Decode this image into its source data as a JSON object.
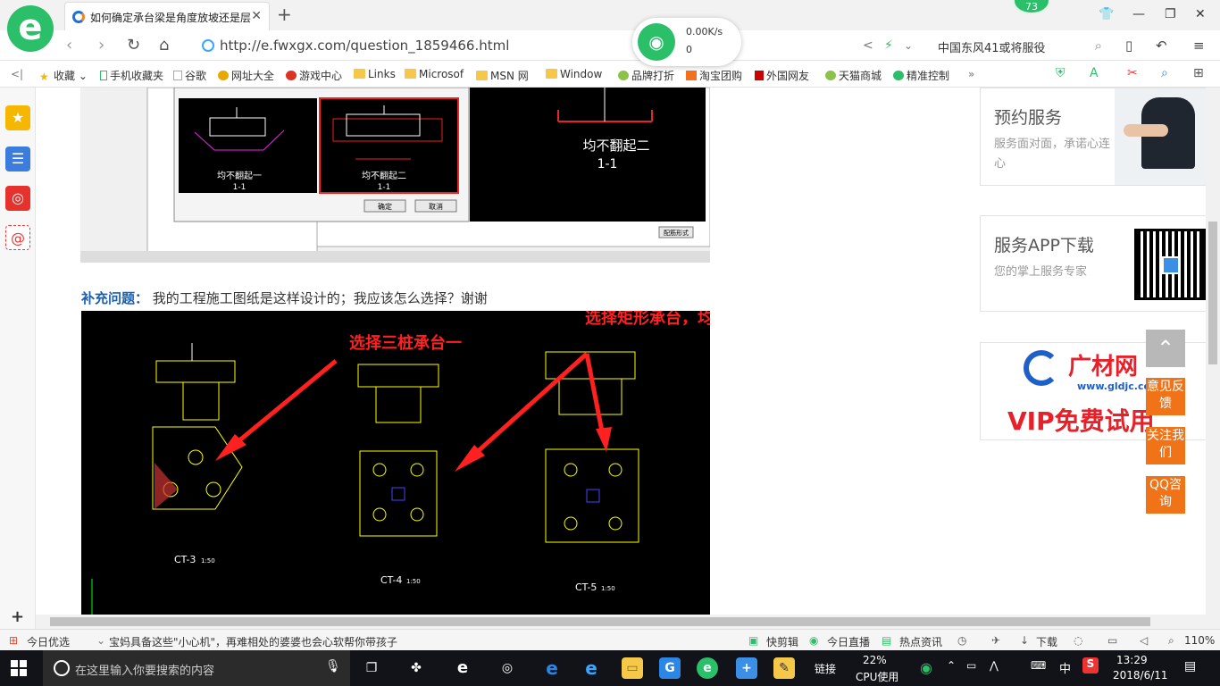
{
  "tab": {
    "title": "如何确定承台梁是角度放坡还是层"
  },
  "titlebar": {
    "badge": "73"
  },
  "address": {
    "url": "http://e.fwxgx.com/question_1859466.html",
    "net_speed": "0.00K/s",
    "net_count": "0"
  },
  "search": {
    "text": "中国东风41或将服役"
  },
  "bookmarks": [
    {
      "label": "收藏"
    },
    {
      "label": "手机收藏夹"
    },
    {
      "label": "谷歌"
    },
    {
      "label": "网址大全"
    },
    {
      "label": "游戏中心"
    },
    {
      "label": "Links"
    },
    {
      "label": "Microsof"
    },
    {
      "label": "MSN 网"
    },
    {
      "label": "Window"
    },
    {
      "label": "品牌打折"
    },
    {
      "label": "淘宝团购"
    },
    {
      "label": "外国网友"
    },
    {
      "label": "天猫商城"
    },
    {
      "label": "精准控制"
    }
  ],
  "cad1": {
    "dialog_label1": "均不翻起一",
    "dialog_label2": "均不翻起二",
    "section1": "1-1",
    "section2": "1-1",
    "ok_btn": "确定",
    "cancel_btn": "取消",
    "big_label": "均不翻起二",
    "big_section": "1-1",
    "param_btn": "配筋形式"
  },
  "supplement": {
    "label": "补充问题：",
    "text": "我的工程施工图纸是这样设计的；我应该怎么选择？谢谢"
  },
  "cad2": {
    "annotation1": "选择三桩承台一",
    "annotation2": "选择矩形承台，均不翻起",
    "ct3": "CT-3",
    "ct4": "CT-4",
    "ct5": "CT-5",
    "scale": "1:50"
  },
  "cards": [
    {
      "title": "预约服务",
      "sub": "服务面对面，承诺心连心"
    },
    {
      "title": "服务APP下载",
      "sub": "您的掌上服务专家"
    }
  ],
  "ad": {
    "brand": "广材网",
    "site": "www.gldjc.com",
    "slogan": "VIP免费试用"
  },
  "float_buttons": [
    {
      "label": "意见反馈"
    },
    {
      "label": "关注我们"
    },
    {
      "label": "QQ咨询"
    }
  ],
  "statusbar": {
    "today": "今日优选",
    "news": "宝妈具备这些\"小心机\"，再难相处的婆婆也会心软帮你带孩子",
    "kuaijian": "快剪辑",
    "live": "今日直播",
    "hotnews": "热点资讯",
    "download": "下载",
    "zoom": "110%"
  },
  "taskbar": {
    "search_placeholder": "在这里输入你要搜索的内容",
    "link": "链接",
    "cpu": "22%",
    "cpu_label": "CPU使用",
    "ime": "中",
    "time": "13:29",
    "date": "2018/6/11"
  },
  "colors": {
    "accent": "#2bbf6a",
    "orange": "#f07318",
    "red_annotation": "#ff2020"
  }
}
